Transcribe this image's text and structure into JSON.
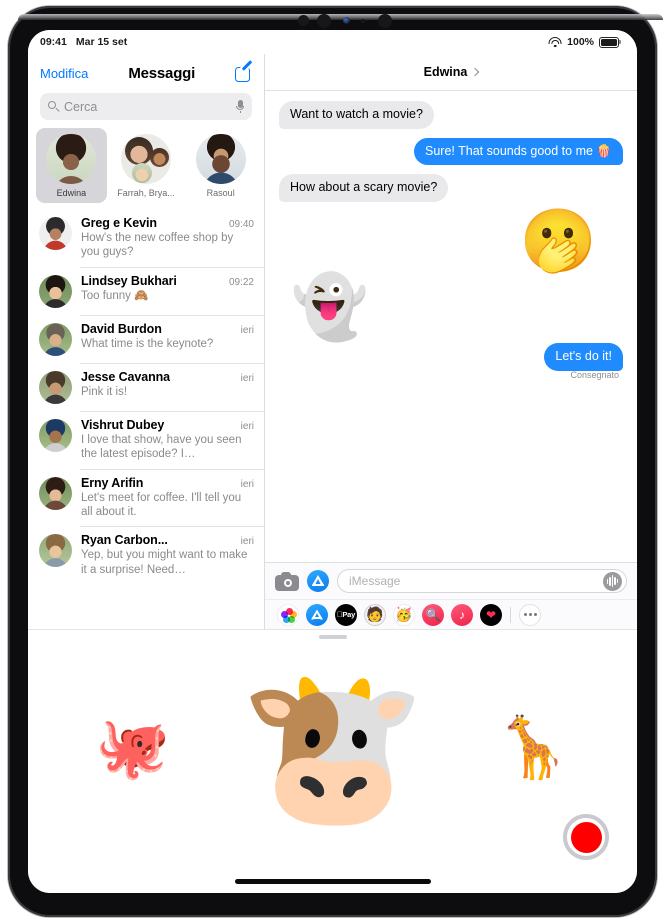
{
  "statusbar": {
    "time": "09:41",
    "date": "Mar 15 set",
    "battery_percent": "100%",
    "wifi_icon": "wifi-icon",
    "battery_icon": "battery-icon"
  },
  "sidebar": {
    "edit_label": "Modifica",
    "title": "Messaggi",
    "compose_icon": "compose-icon",
    "search": {
      "placeholder": "Cerca",
      "search_icon": "search-icon",
      "dictation_icon": "microphone-icon"
    },
    "pinned": [
      {
        "label": "Edwina",
        "selected": true
      },
      {
        "label": "Farrah, Brya...",
        "selected": false
      },
      {
        "label": "Rasoul",
        "selected": false
      }
    ],
    "conversations": [
      {
        "name": "Greg e Kevin",
        "time": "09:40",
        "preview": "How's the new coffee shop by you guys?"
      },
      {
        "name": "Lindsey Bukhari",
        "time": "09:22",
        "preview": "Too funny 🙈"
      },
      {
        "name": "David Burdon",
        "time": "ieri",
        "preview": "What time is the keynote?"
      },
      {
        "name": "Jesse Cavanna",
        "time": "ieri",
        "preview": "Pink it is!"
      },
      {
        "name": "Vishrut Dubey",
        "time": "ieri",
        "preview": "I love that show, have you seen the latest episode? I…"
      },
      {
        "name": "Erny Arifin",
        "time": "ieri",
        "preview": "Let's meet for coffee. I'll tell you all about it."
      },
      {
        "name": "Ryan Carbon...",
        "time": "ieri",
        "preview": "Yep, but you might want to make it a surprise! Need…"
      }
    ]
  },
  "chat": {
    "title": "Edwina",
    "details_icon": "chevron-right-icon",
    "messages": [
      {
        "kind": "bubble",
        "side": "in",
        "text": "Want to watch a movie?"
      },
      {
        "kind": "bubble",
        "side": "out",
        "text": "Sure! That sounds good to me 🍿"
      },
      {
        "kind": "bubble",
        "side": "in",
        "text": "How about a scary movie?"
      },
      {
        "kind": "sticker",
        "side": "out",
        "glyph": "🫢",
        "name": "memoji-shocked-sticker"
      },
      {
        "kind": "sticker",
        "side": "in",
        "glyph": "👻",
        "name": "ghost-memoji-sticker"
      },
      {
        "kind": "bubble",
        "side": "out",
        "text": "Let's do it!"
      }
    ],
    "delivered_label": "Consegnato",
    "input": {
      "camera_icon": "camera-icon",
      "appstore_icon": "app-store-icon",
      "placeholder": "iMessage",
      "audio_icon": "audio-message-icon"
    },
    "app_drawer": [
      {
        "name": "photos-app-icon",
        "glyph": ""
      },
      {
        "name": "app-store-app-icon",
        "glyph": ""
      },
      {
        "name": "apple-pay-app-icon",
        "glyph": "Pay"
      },
      {
        "name": "memoji-app-icon",
        "glyph": "🧑"
      },
      {
        "name": "animoji-app-icon",
        "glyph": "🥳"
      },
      {
        "name": "image-search-app-icon",
        "glyph": "🔍"
      },
      {
        "name": "music-app-icon",
        "glyph": "♪"
      },
      {
        "name": "digital-touch-app-icon",
        "glyph": "❤"
      },
      {
        "name": "more-apps-icon",
        "glyph": ""
      }
    ]
  },
  "memoji_panel": {
    "grabber_icon": "drag-handle-icon",
    "items": [
      {
        "name": "octopus-animoji",
        "glyph": "🐙",
        "size": "small"
      },
      {
        "name": "cow-animoji",
        "glyph": "🐮",
        "size": "large"
      },
      {
        "name": "giraffe-animoji",
        "glyph": "🦒",
        "size": "small"
      }
    ],
    "record_button_icon": "record-button",
    "home_indicator": "home-indicator"
  },
  "colors": {
    "accent_blue": "#007aff",
    "bubble_out": "#1f8bff",
    "bubble_in": "#e9e9eb",
    "record_red": "#ff0000"
  }
}
